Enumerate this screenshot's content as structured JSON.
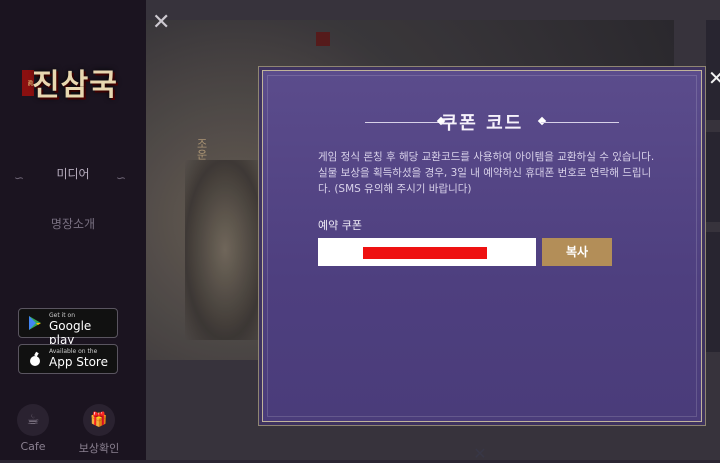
{
  "sidebar": {
    "logo_text": "진삼국",
    "nav": {
      "media": "미디어",
      "general_intro": "명장소개"
    },
    "stores": {
      "google_small": "Get it on",
      "google_big": "Google play",
      "apple_small": "Available on the",
      "apple_big": "App Store"
    },
    "quick_links": {
      "cafe": "Cafe",
      "reward_check": "보상확인"
    }
  },
  "background": {
    "hero_name": "조운"
  },
  "modal": {
    "title": "쿠폰 코드",
    "description": "게임 정식 론칭 후 해당 교환코드를 사용하여 아이템을 교환하실 수 있습니다. 실물 보상을 획득하셨을 경우, 3일 내 예약하신 휴대폰 번호로 연락해 드립니다. (SMS 유의해 주시기 바랍니다)",
    "coupon_label": "예약 쿠폰",
    "coupon_value": "",
    "copy_label": "복사"
  },
  "colors": {
    "modal_bg": "#5b4c8c",
    "copy_button": "#b38e58",
    "redaction": "#ee1111"
  }
}
